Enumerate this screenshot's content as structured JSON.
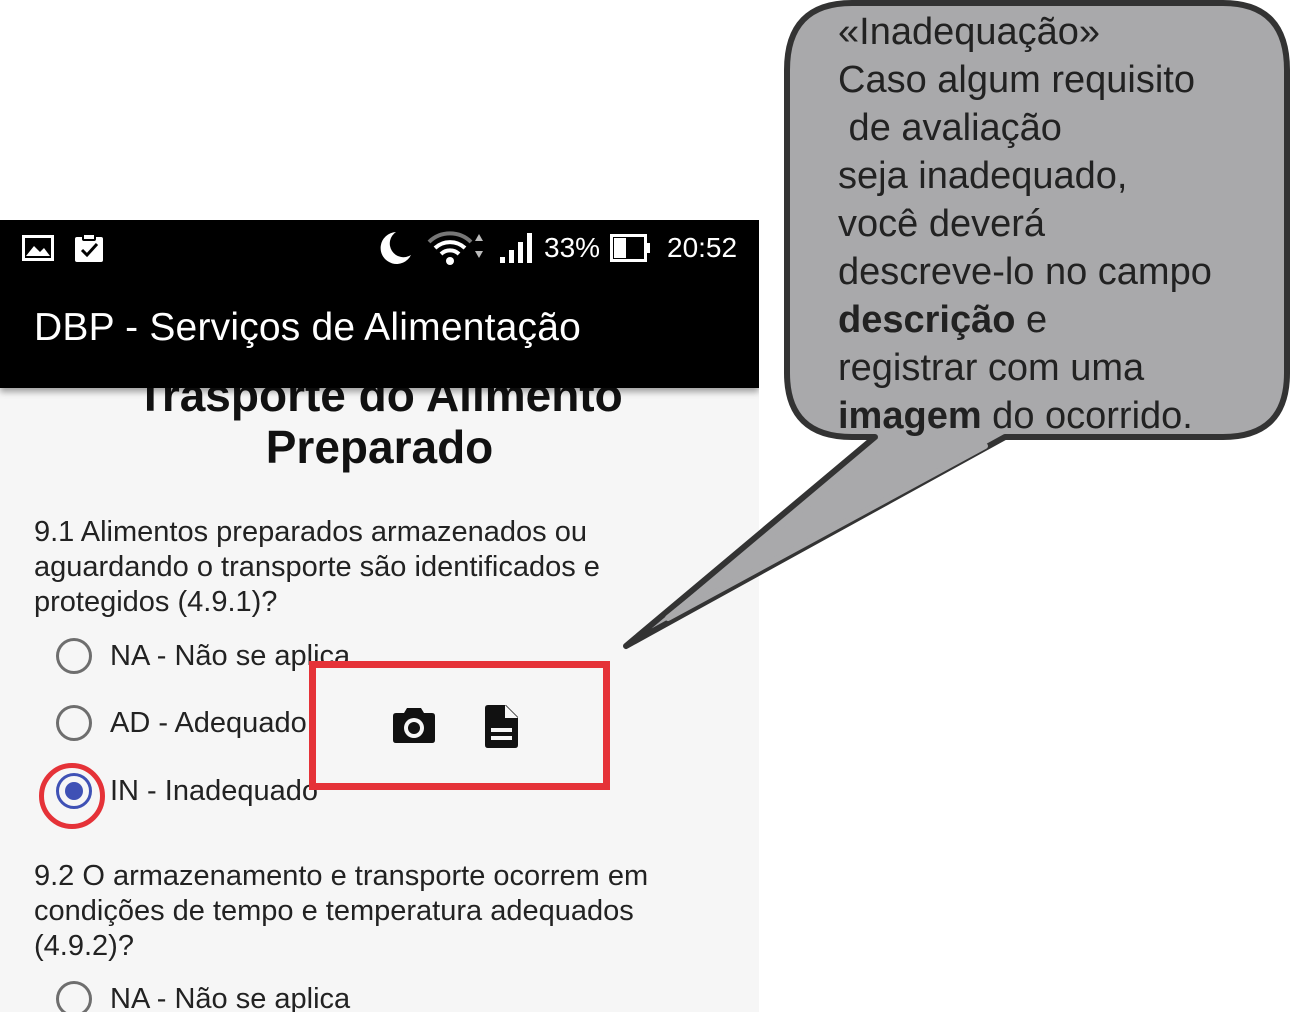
{
  "status_bar": {
    "battery_percent": "33%",
    "time": "20:52",
    "icons": [
      "image-icon",
      "clipboard-check-icon",
      "moon-icon",
      "wifi-icon",
      "signal-icon",
      "battery-icon"
    ]
  },
  "app_bar": {
    "title": "DBP - Serviços de Alimentação"
  },
  "section": {
    "title_line1": "Trasporte do Alimento",
    "title_line2": "Preparado"
  },
  "questions": [
    {
      "text": "9.1 Alimentos preparados armazenados ou aguardando o transporte são identificados e protegidos (4.9.1)?",
      "options": [
        {
          "label": "NA - Não se aplica",
          "checked": false
        },
        {
          "label": "AD - Adequado",
          "checked": false
        },
        {
          "label": "IN - Inadequado",
          "checked": true
        }
      ],
      "actions": [
        "camera-icon",
        "description-icon"
      ]
    },
    {
      "text": "9.2 O armazenamento e transporte ocorrem em condições de tempo e temperatura adequados (4.9.2)?",
      "options": [
        {
          "label": "NA - Não se aplica",
          "checked": false
        }
      ]
    }
  ],
  "callout": {
    "line1": "«Inadequação»",
    "line2": "Caso algum requisito",
    "line3": " de avaliação",
    "line4": "seja inadequado,",
    "line5": "você deverá",
    "line6": "descreve-lo no campo",
    "line7_bold": "descrição",
    "line7_rest": " e",
    "line8": "registrar com uma",
    "line9_bold": "imagem",
    "line9_rest": " do ocorrido."
  },
  "colors": {
    "accent": "#3f51b5",
    "highlight": "#e53238",
    "callout_fill": "#a9a9ab",
    "app_bar": "#000000"
  }
}
